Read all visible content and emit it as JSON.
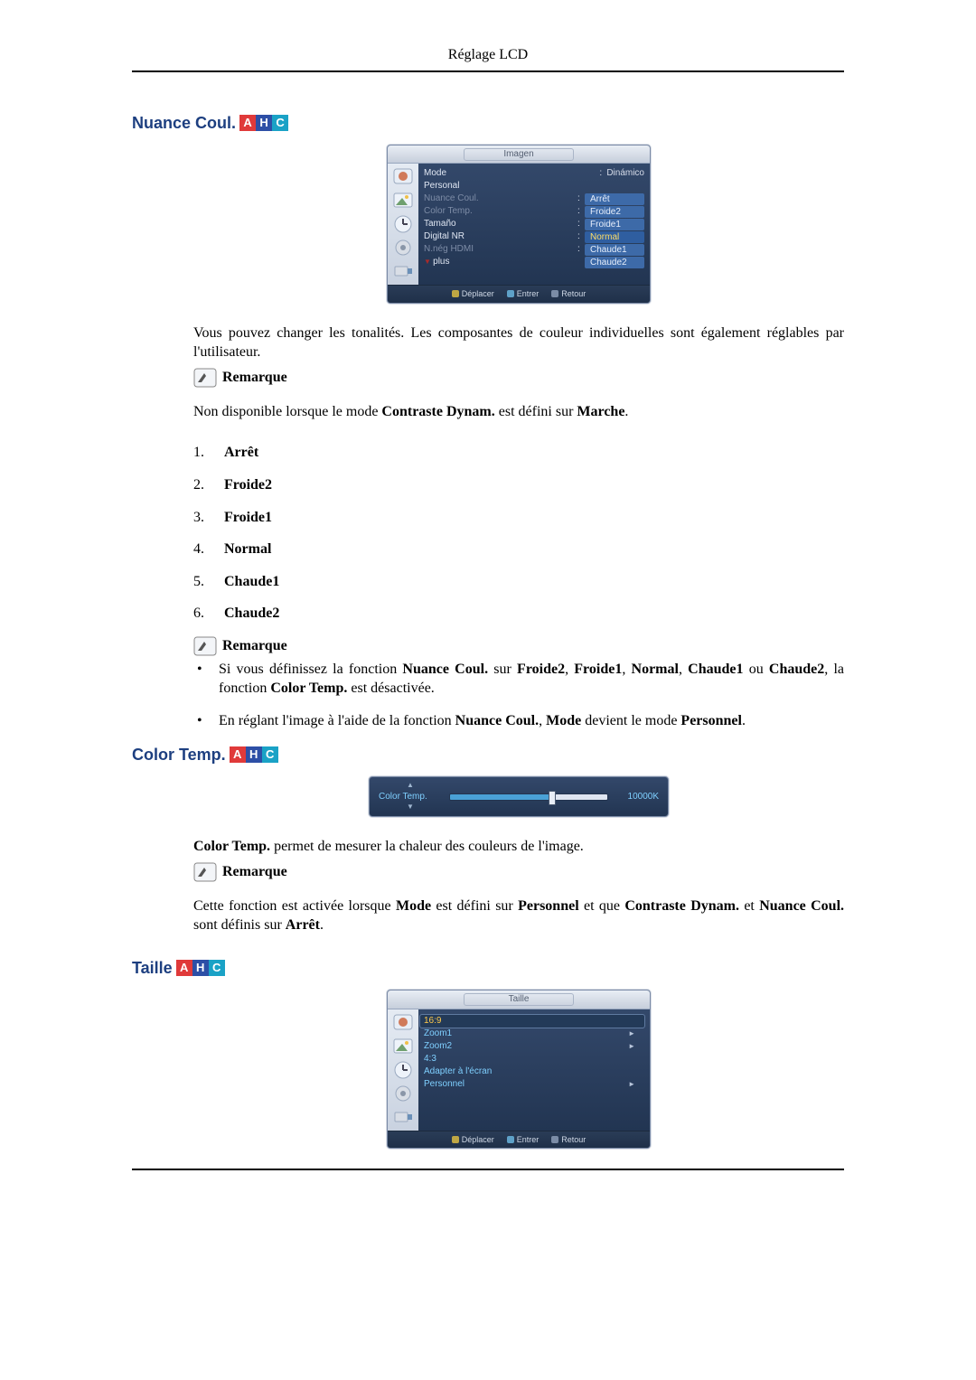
{
  "header": {
    "title": "Réglage LCD"
  },
  "badge": {
    "a": "A",
    "h": "H",
    "c": "C"
  },
  "sections": {
    "nuance": {
      "heading": "Nuance Coul.",
      "intro": "Vous pouvez changer les tonalités. Les composantes de couleur individuelles sont également réglables par l'utilisateur.",
      "note1_label": "Remarque",
      "note1_text_before": "Non disponible lorsque le mode ",
      "note1_bold1": "Contraste Dynam.",
      "note1_mid": " est défini sur ",
      "note1_bold2": "Marche",
      "note1_after": ".",
      "options": [
        "Arrêt",
        "Froide2",
        "Froide1",
        "Normal",
        "Chaude1",
        "Chaude2"
      ],
      "note2_label": "Remarque",
      "bullets": [
        {
          "pre": "Si vous définissez la fonction ",
          "b1": "Nuance Coul.",
          "m1": " sur ",
          "b2": "Froide2",
          "m2": ", ",
          "b3": "Froide1",
          "m3": ", ",
          "b4": "Normal",
          "m4": ", ",
          "b5": "Chaude1",
          "m5": " ou ",
          "b6": "Chaude2",
          "m6": ", la fonction ",
          "b7": "Color Temp.",
          "post": " est désactivée."
        },
        {
          "pre": "En réglant l'image à l'aide de la fonction ",
          "b1": "Nuance Coul.",
          "m1": ", ",
          "b2": "Mode",
          "m2": " devient le mode ",
          "b3": "Personnel",
          "post": "."
        }
      ],
      "osd": {
        "title": "Imagen",
        "rows": {
          "mode_k": "Mode",
          "mode_v": "Dinámico",
          "pers_k": "Personal",
          "nuance_k": "Nuance Coul.",
          "ctemp_k": "Color Temp.",
          "tam_k": "Tamaño",
          "nr_k": "Digital NR",
          "hdmi_k": "N.nég HDMI",
          "plus_k": "plus"
        },
        "pills": [
          "Arrêt",
          "Froide2",
          "Froide1",
          "Normal",
          "Chaude1",
          "Chaude2"
        ],
        "pill_selected_index": 3,
        "footer": {
          "move": "Déplacer",
          "enter": "Entrer",
          "back": "Retour"
        }
      }
    },
    "colortemp": {
      "heading": "Color Temp.",
      "osd": {
        "label": "Color Temp.",
        "value": "10000K",
        "percent": 65
      },
      "desc_b1": "Color Temp.",
      "desc_after": " permet de mesurer la chaleur des couleurs de l'image.",
      "note_label": "Remarque",
      "note_p": {
        "pre": "Cette fonction est activée lorsque ",
        "b1": "Mode",
        "m1": " est défini sur ",
        "b2": "Personnel",
        "m2": " et que ",
        "b3": "Contraste Dynam.",
        "m3": " et ",
        "b4": "Nuance Coul.",
        "m4": " sont définis sur ",
        "b5": "Arrêt",
        "post": "."
      }
    },
    "taille": {
      "heading": "Taille",
      "osd": {
        "title": "Taille",
        "options": [
          {
            "label": "16:9",
            "arrow": false,
            "selected": true
          },
          {
            "label": "Zoom1",
            "arrow": true,
            "selected": false
          },
          {
            "label": "Zoom2",
            "arrow": true,
            "selected": false
          },
          {
            "label": "4:3",
            "arrow": false,
            "selected": false
          },
          {
            "label": "Adapter à l'écran",
            "arrow": false,
            "selected": false
          },
          {
            "label": "Personnel",
            "arrow": true,
            "selected": false
          }
        ],
        "footer": {
          "move": "Déplacer",
          "enter": "Entrer",
          "back": "Retour"
        }
      }
    }
  }
}
